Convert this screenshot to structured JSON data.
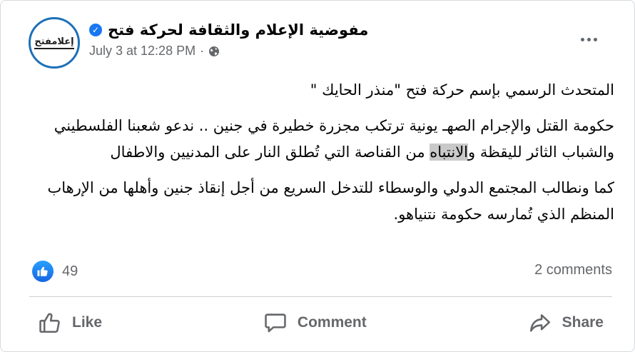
{
  "post": {
    "avatar_text": "إعلامفتح",
    "page_name": "مفوضية الإعلام والثقافة لحركة فتح",
    "timestamp": "July 3 at 12:28 PM",
    "separator": "·",
    "privacy_icon": "globe-icon",
    "verified_icon": "✓",
    "paragraphs": {
      "p1": "المتحدث الرسمي بإسم حركة فتح \"منذر الحايك \"",
      "p2_a": "حكومة القتل والإجرام الصهـ يونية  ترتكب مجزرة خطيرة في جنين .. ندعو شعبنا الفلسطيني والشباب الثائر لليقظة و",
      "p2_highlight": "الانتباه",
      "p2_b": " من القناصة التي تُطلق النار على المدنيين والاطفال",
      "p3": "كما ونطالب المجتمع الدولي والوسطاء للتدخل السريع من أجل إنقاذ جنين وأهلها من الإرهاب المنظم الذي تُمارسه حكومة نتنياهو."
    }
  },
  "stats": {
    "reaction_icon": "like-icon",
    "reaction_count": "49",
    "comments": "2 comments"
  },
  "actions": {
    "like_label": "Like",
    "comment_label": "Comment",
    "share_label": "Share"
  },
  "colors": {
    "accent": "#1877f2",
    "secondary_text": "#65676b"
  }
}
